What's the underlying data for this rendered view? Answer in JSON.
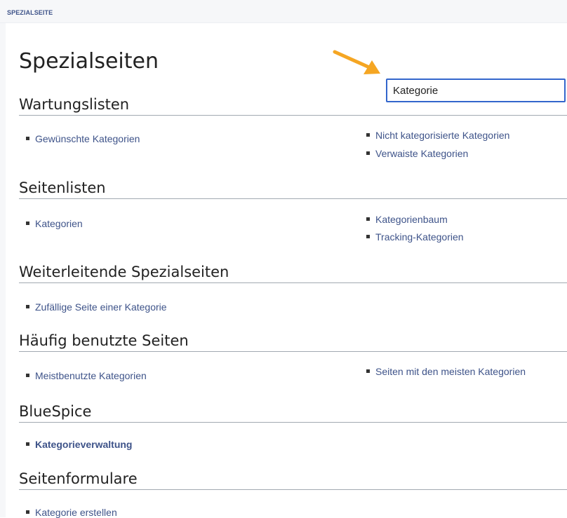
{
  "header": {
    "tag": "SPEZIALSEITE"
  },
  "page_title": "Spezialseiten",
  "filter": {
    "value": "Kategorie"
  },
  "accent_colors": {
    "arrow": "#f5a623",
    "link": "#3e5389",
    "input_border": "#3366cc"
  },
  "sections": [
    {
      "heading": "Wartungslisten",
      "links": [
        "Gewünschte Kategorien",
        "Nicht kategorisierte Kategorien",
        "Verwaiste Kategorien"
      ]
    },
    {
      "heading": "Seitenlisten",
      "links": [
        "Kategorien",
        "Kategorienbaum",
        "Tracking-Kategorien"
      ]
    },
    {
      "heading": "Weiterleitende Spezialseiten",
      "links": [
        "Zufällige Seite einer Kategorie"
      ]
    },
    {
      "heading": "Häufig benutzte Seiten",
      "links": [
        "Meistbenutzte Kategorien",
        "Seiten mit den meisten Kategorien"
      ]
    },
    {
      "heading": "BlueSpice",
      "links": [
        "Kategorieverwaltung"
      ]
    },
    {
      "heading": "Seitenformulare",
      "links": [
        "Kategorie erstellen"
      ]
    }
  ],
  "icons": {
    "pointer": "arrow-pointer-icon",
    "bullet": "bullet-icon"
  }
}
